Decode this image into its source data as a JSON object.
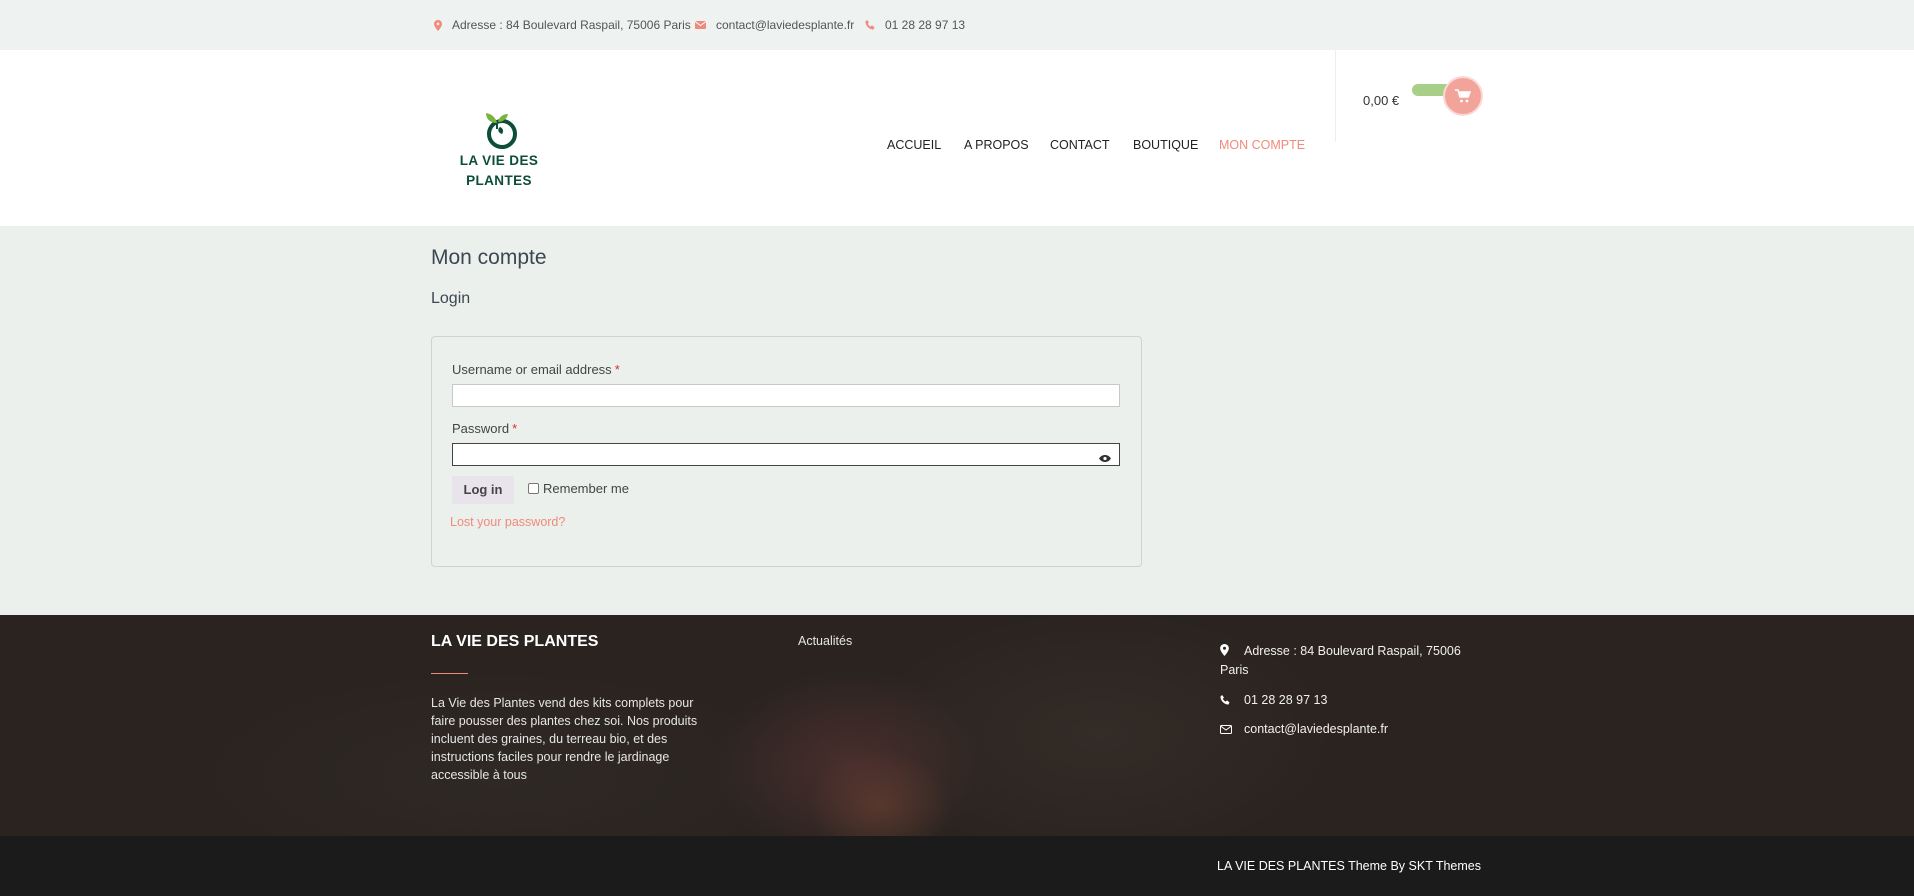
{
  "topbar": {
    "address": "Adresse : 84 Boulevard Raspail, 75006 Paris",
    "email": "contact@laviedesplante.fr",
    "phone": "01 28 28 97 13"
  },
  "logo": {
    "line1": "LA VIE DES",
    "line2": "PLANTES"
  },
  "nav": {
    "items": [
      {
        "label": "ACCUEIL"
      },
      {
        "label": "A PROPOS"
      },
      {
        "label": "CONTACT"
      },
      {
        "label": "BOUTIQUE"
      },
      {
        "label": "MON COMPTE",
        "active": true
      }
    ]
  },
  "cart": {
    "total": "0,00 €",
    "icon": "cart-icon"
  },
  "main": {
    "page_title": "Mon compte",
    "section_title": "Login",
    "form": {
      "username_label": "Username or email address",
      "username_value": "",
      "password_label": "Password",
      "password_value": "",
      "required_mark": "*",
      "login_button": "Log in",
      "remember_label": "Remember me",
      "remember_checked": false,
      "lost_password": "Lost your password?"
    }
  },
  "footer": {
    "title": "LA VIE DES PLANTES",
    "description": "La Vie des Plantes vend des kits complets pour faire pousser des plantes chez soi. Nos produits incluent des graines, du terreau bio, et des instructions faciles pour rendre le jardinage accessible à tous",
    "link": "Actualités",
    "address": "Adresse : 84 Boulevard Raspail, 75006 Paris",
    "phone": "01 28 28 97 13",
    "email": "contact@laviedesplante.fr",
    "credit": "LA VIE DES PLANTES Theme By SKT Themes"
  },
  "colors": {
    "accent": "#f08a7c",
    "green": "#a8cf88",
    "brand": "#0d4d3a"
  }
}
